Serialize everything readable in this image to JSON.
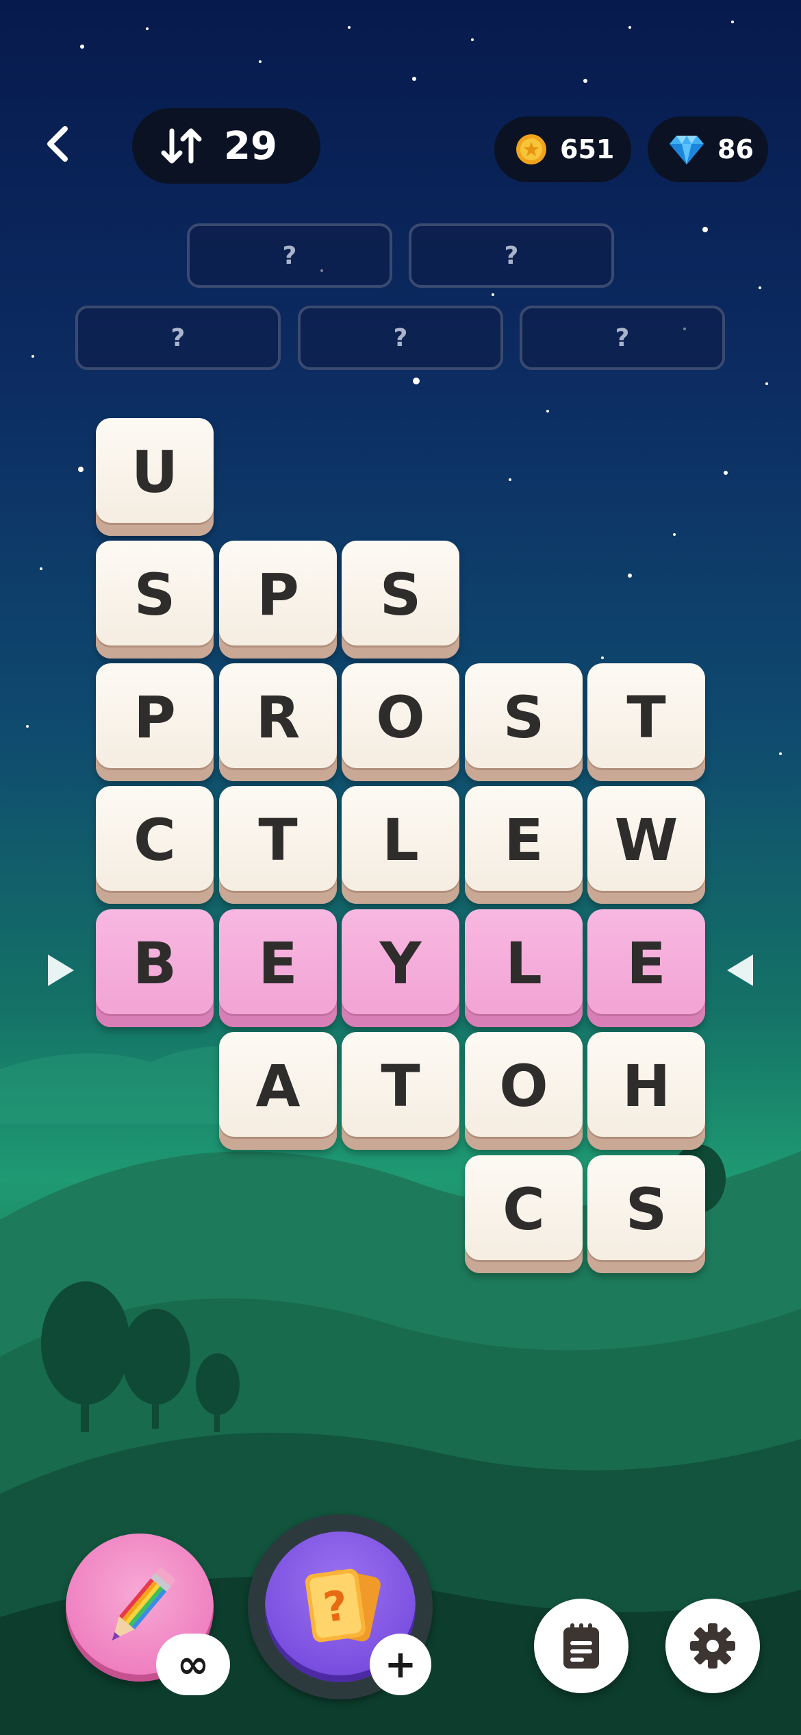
{
  "header": {
    "moves_count": "29",
    "coins": "651",
    "gems": "86"
  },
  "icons": {
    "back": "chevron-left-icon",
    "moves": "swap-arrows-icon",
    "coin": "coin-icon",
    "gem": "diamond-icon",
    "pencil": "pencil-icon",
    "hint": "question-card-icon",
    "notes": "notepad-icon",
    "settings": "gear-icon"
  },
  "answer_slots": [
    "?",
    "?",
    "?",
    "?",
    "?"
  ],
  "grid": {
    "rows": [
      [
        "U",
        "",
        "",
        "",
        ""
      ],
      [
        "S",
        "P",
        "S",
        "",
        ""
      ],
      [
        "P",
        "R",
        "O",
        "S",
        "T"
      ],
      [
        "C",
        "T",
        "L",
        "E",
        "W"
      ],
      [
        "B",
        "E",
        "Y",
        "L",
        "E"
      ],
      [
        "",
        "A",
        "T",
        "O",
        "H"
      ],
      [
        "",
        "",
        "",
        "C",
        "S"
      ]
    ],
    "highlighted_row": 4
  },
  "powerups": {
    "pencil_count": "∞",
    "hint_add": "+"
  },
  "colors": {
    "tile": "#f6eee3",
    "tile_highlight": "#f3a6d6",
    "pill_bg": "#0b1224",
    "slot_border": "#3a4a70"
  }
}
